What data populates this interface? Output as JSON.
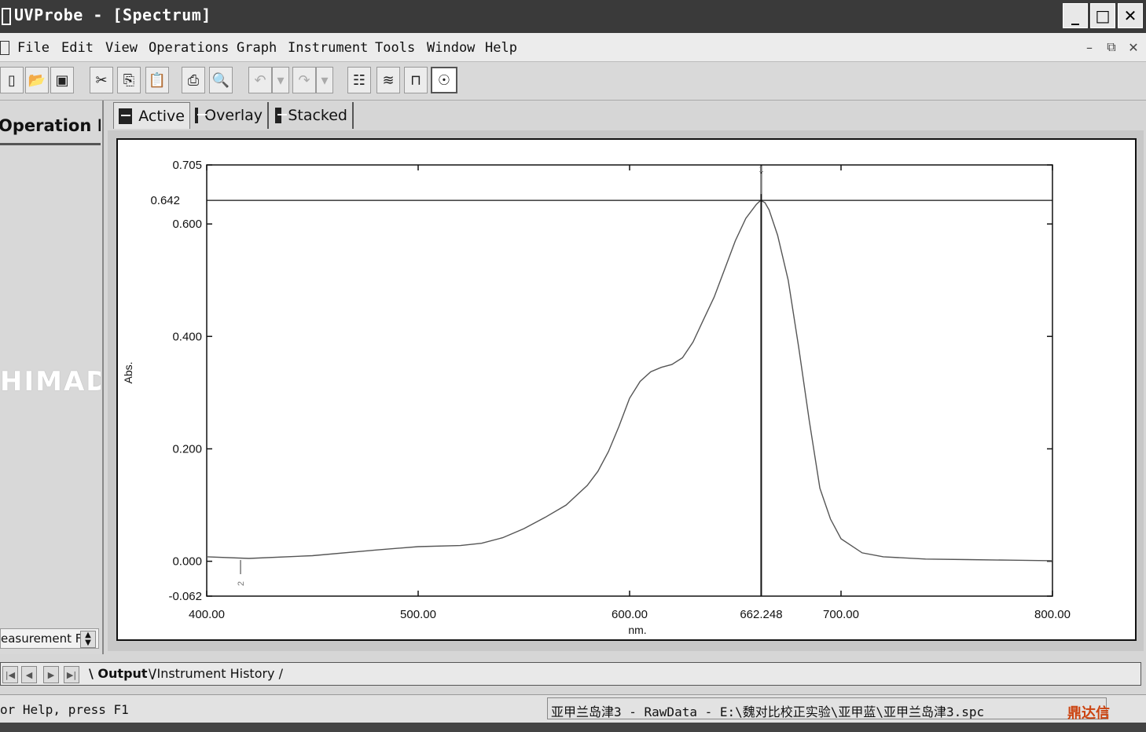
{
  "window": {
    "title": "UVProbe - [Spectrum]",
    "buttons": {
      "minimize": "_",
      "maximize": "□",
      "close": "✕"
    }
  },
  "menu": {
    "items": [
      "File",
      "Edit",
      "View",
      "Operations",
      "Graph",
      "Instrument",
      "Tools",
      "Window",
      "Help"
    ],
    "mdi": {
      "minimize": "–",
      "restore": "⧉",
      "close": "✕"
    }
  },
  "toolbar": {
    "buttons": [
      {
        "icon": "new-file-icon",
        "glyph": "▯"
      },
      {
        "icon": "open-folder-icon",
        "glyph": "📂"
      },
      {
        "icon": "save-icon",
        "glyph": "▣"
      },
      {
        "icon": "cut-icon",
        "glyph": "✂"
      },
      {
        "icon": "copy-icon",
        "glyph": "⎘"
      },
      {
        "icon": "paste-icon",
        "glyph": "📋"
      },
      {
        "icon": "print-icon",
        "glyph": "⎙"
      },
      {
        "icon": "print-preview-icon",
        "glyph": "🔍"
      },
      {
        "icon": "undo-icon",
        "glyph": "↶"
      },
      {
        "icon": "undo-dropdown-icon",
        "glyph": "▾"
      },
      {
        "icon": "redo-icon",
        "glyph": "↷"
      },
      {
        "icon": "redo-dropdown-icon",
        "glyph": "▾"
      },
      {
        "icon": "method-icon",
        "glyph": "☷"
      },
      {
        "icon": "spectrum-window-icon",
        "glyph": "≋"
      },
      {
        "icon": "instrument-icon",
        "glyph": "⊓"
      },
      {
        "icon": "connect-icon",
        "glyph": "☉"
      }
    ]
  },
  "left_panel": {
    "title": "Operation Pa",
    "logo": "HIMAD",
    "measurement_label": "easurement F"
  },
  "tabs": [
    {
      "label": "Active",
      "icon": "spectrum-tab-icon"
    },
    {
      "label": "Overlay",
      "icon": "spectrum-tab-icon"
    },
    {
      "label": "Stacked",
      "icon": "spectrum-tab-icon"
    }
  ],
  "chart_data": {
    "type": "line",
    "title": "",
    "xlabel": "nm.",
    "ylabel": "Abs.",
    "xlim": [
      400.0,
      800.0
    ],
    "ylim": [
      -0.062,
      0.705
    ],
    "x_ticks": [
      "400.00",
      "500.00",
      "600.00",
      "662.248",
      "700.00",
      "800.00"
    ],
    "x_tick_values": [
      400,
      500,
      600,
      662.248,
      700,
      800
    ],
    "y_ticks": [
      "-0.062",
      "0.000",
      "0.200",
      "0.400",
      "0.600",
      "0.705"
    ],
    "y_tick_values": [
      -0.062,
      0.0,
      0.2,
      0.4,
      0.6,
      0.705
    ],
    "cursor": {
      "x": 662.248,
      "y": 0.642,
      "x_label": "662.248",
      "y_label": "0.642"
    },
    "peak_markers": [
      {
        "x": 662.248,
        "y": 0.642,
        "label": "1"
      },
      {
        "x": 416.0,
        "y": 0.005,
        "label": "2"
      }
    ],
    "series": [
      {
        "x": [
          400,
          420,
          450,
          480,
          500,
          520,
          530,
          540,
          550,
          560,
          570,
          580,
          585,
          590,
          595,
          600,
          605,
          610,
          615,
          620,
          625,
          630,
          635,
          640,
          645,
          650,
          655,
          660,
          662,
          664,
          666,
          670,
          675,
          680,
          685,
          690,
          695,
          700,
          710,
          720,
          740,
          760,
          780,
          800
        ],
        "y": [
          0.008,
          0.005,
          0.01,
          0.02,
          0.026,
          0.028,
          0.032,
          0.042,
          0.058,
          0.078,
          0.1,
          0.135,
          0.16,
          0.195,
          0.24,
          0.29,
          0.32,
          0.337,
          0.345,
          0.35,
          0.362,
          0.39,
          0.43,
          0.47,
          0.52,
          0.57,
          0.61,
          0.635,
          0.642,
          0.638,
          0.625,
          0.58,
          0.5,
          0.38,
          0.25,
          0.13,
          0.075,
          0.04,
          0.015,
          0.008,
          0.004,
          0.003,
          0.002,
          0.001
        ]
      }
    ],
    "grid": false
  },
  "output_tabs": [
    "Output",
    "Instrument History"
  ],
  "status": {
    "help": "or Help, press F1",
    "file": "亚甲兰岛津3 - RawData - E:\\魏对比校正实验\\亚甲蓝\\亚甲兰岛津3.spc",
    "watermark": "鼎达信"
  }
}
